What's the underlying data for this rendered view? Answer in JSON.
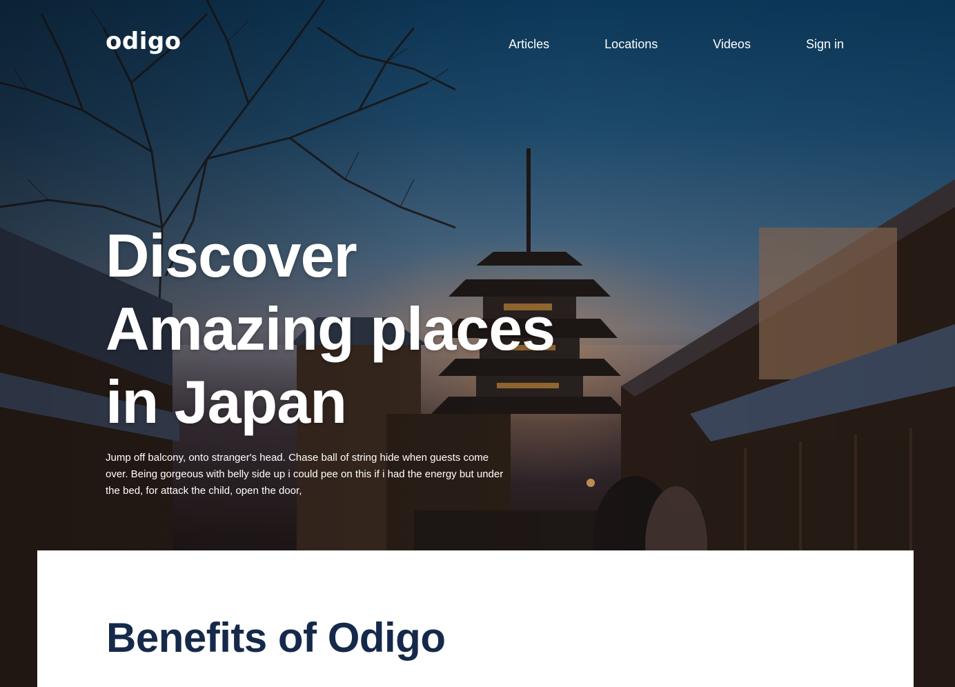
{
  "brand": {
    "logo_text": "odigo"
  },
  "nav": {
    "items": [
      {
        "label": "Articles"
      },
      {
        "label": "Locations"
      },
      {
        "label": "Videos"
      },
      {
        "label": "Sign in"
      }
    ]
  },
  "hero": {
    "headline_lines": [
      "Discover",
      "Amazing places",
      "in Japan"
    ],
    "lede": "Jump off balcony, onto stranger's head. Chase ball of string hide when guests come over. Being gorgeous with belly side up i could pee on this if i had the energy but under the bed, for attack the child, open the door,"
  },
  "benefits": {
    "title": "Benefits of Odigo"
  },
  "colors": {
    "heading_navy": "#15294a",
    "text_white": "#ffffff"
  }
}
